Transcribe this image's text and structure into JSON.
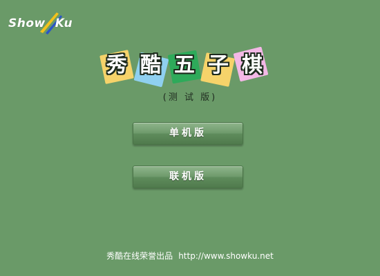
{
  "logo": {
    "text_left": "Show",
    "text_right": "Ku",
    "icon": "slash-swoosh-icon"
  },
  "title": {
    "chars": [
      "秀",
      "酷",
      "五",
      "子",
      "棋"
    ],
    "tile_colors": [
      "#f6d36a",
      "#8fd0f0",
      "#2eaa5a",
      "#f6d36a",
      "#f3b8e6"
    ]
  },
  "subtitle": "(测 试 版)",
  "menu": {
    "single_player": "单机版",
    "online": "联机版"
  },
  "footer": {
    "credit": "秀酷在线荣誉出品",
    "url": "http://www.showku.net"
  },
  "colors": {
    "background": "#6a9a68",
    "button": "#6e9a6b"
  }
}
